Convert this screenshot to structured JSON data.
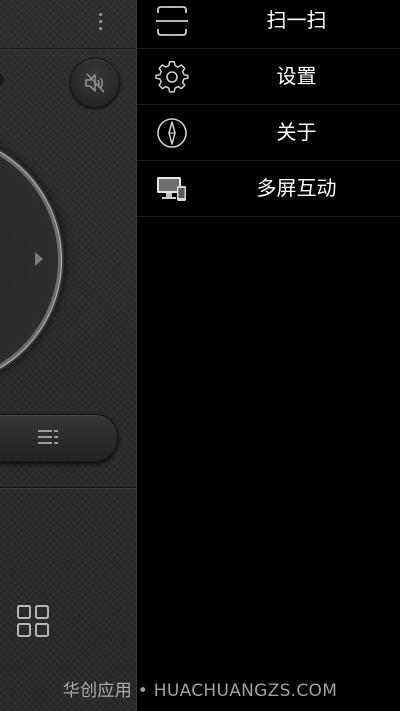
{
  "remote": {
    "more_icon": "more-vertical-icon",
    "mute_icon": "speaker-muted-icon",
    "dpad_right_icon": "triangle-right-icon",
    "menu_icon": "menu-lines-icon",
    "apps_icon": "grid-apps-icon"
  },
  "drawer": {
    "items": [
      {
        "label": "扫一扫",
        "icon": "scan-icon"
      },
      {
        "label": "设置",
        "icon": "gear-icon"
      },
      {
        "label": "关于",
        "icon": "compass-icon"
      },
      {
        "label": "多屏互动",
        "icon": "multi-screen-icon"
      }
    ]
  },
  "watermark": {
    "text": "华创应用 • HUACHUANGZS.COM"
  },
  "colors": {
    "drawer_background": "#000000",
    "remote_background": "#2b2b2b",
    "menu_text": "#ffffff",
    "icon_stroke": "#cfcfcf"
  }
}
